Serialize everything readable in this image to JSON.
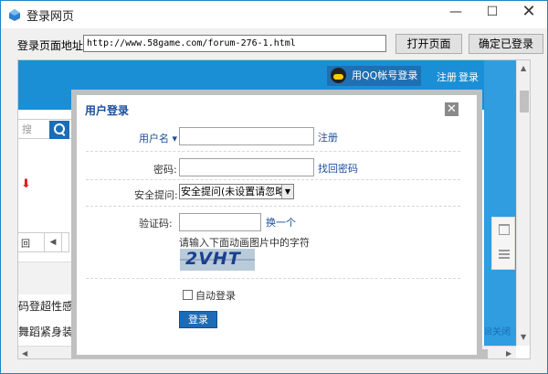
{
  "window": {
    "title": "登录网页",
    "minimize": "—",
    "maximize": "☐",
    "close": "✕"
  },
  "toolbar": {
    "url_label": "登录页面地址:",
    "url_value": "http://www.58game.com/forum-276-1.html",
    "open_button": "打开页面",
    "confirm_button": "确定已登录"
  },
  "site": {
    "qq_login": "用QQ帐号登录",
    "register": "注册",
    "login": "登录",
    "search_placeholder": "搜",
    "pager_item": "回",
    "thread_1": "码登超性感媚",
    "thread_2": "舞蹈紧身装徜",
    "close_link": "☒关闭"
  },
  "dialog": {
    "title": "用户登录",
    "close": "✕",
    "username_label": "用户名 ▾",
    "register_link": "注册",
    "password_label": "密码:",
    "forgot_link": "找回密码",
    "question_label": "安全提问:",
    "question_value": "安全提问(未设置请忽略)",
    "captcha_label": "验证码:",
    "change_link": "换一个",
    "captcha_hint": "请输入下面动画图片中的字符",
    "captcha_text": "2VHT",
    "auto_login": "自动登录",
    "submit": "登录"
  }
}
